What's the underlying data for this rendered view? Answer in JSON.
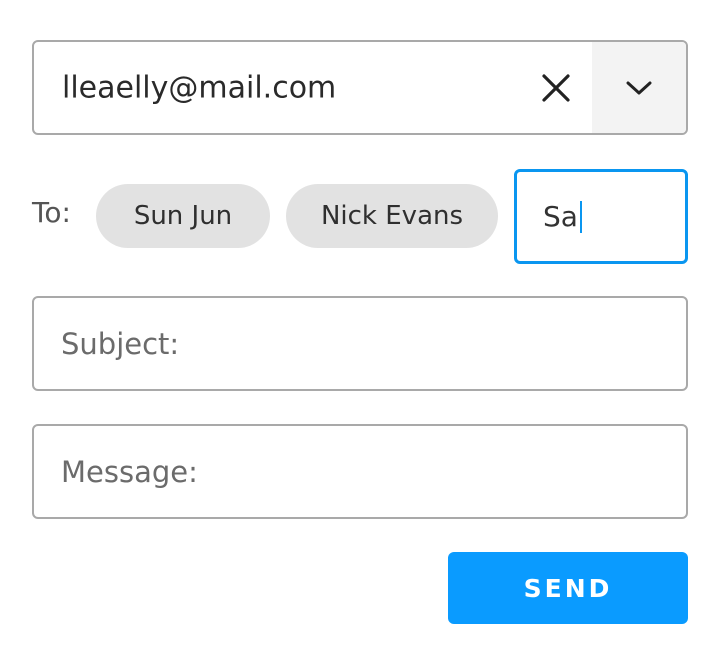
{
  "from": {
    "value": "lleaelly@mail.com",
    "clear_icon": "close-icon",
    "dropdown_icon": "chevron-down-icon"
  },
  "to": {
    "label": "To:",
    "recipients": [
      {
        "name": "Sun Jun"
      },
      {
        "name": "Nick Evans"
      }
    ],
    "input_value": "Sa"
  },
  "subject": {
    "placeholder": "Subject:"
  },
  "message": {
    "placeholder": "Message:"
  },
  "send_button": {
    "label": "SEND"
  },
  "colors": {
    "accent": "#0a9bff",
    "focus_border": "#0a96f0",
    "border": "#a9a9a9",
    "chip_bg": "#e2e2e2",
    "dropdown_bg": "#f3f3f3"
  }
}
